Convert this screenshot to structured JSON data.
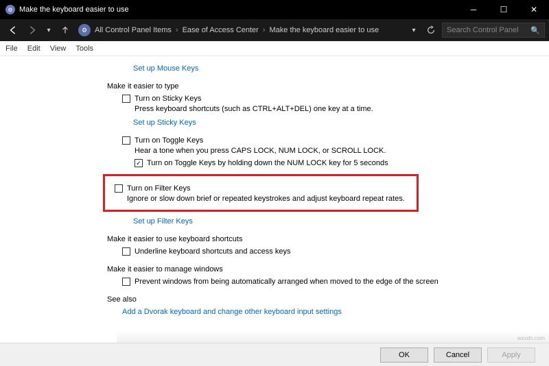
{
  "titlebar": {
    "title": "Make the keyboard easier to use"
  },
  "breadcrumb": {
    "items": [
      "All Control Panel Items",
      "Ease of Access Center",
      "Make the keyboard easier to use"
    ]
  },
  "search": {
    "placeholder": "Search Control Panel"
  },
  "menubar": {
    "file": "File",
    "edit": "Edit",
    "view": "View",
    "tools": "Tools"
  },
  "content": {
    "link_mouse_keys": "Set up Mouse Keys",
    "section_type": "Make it easier to type",
    "sticky_label": "Turn on Sticky Keys",
    "sticky_desc": "Press keyboard shortcuts (such as CTRL+ALT+DEL) one key at a time.",
    "link_sticky": "Set up Sticky Keys",
    "toggle_label": "Turn on Toggle Keys",
    "toggle_desc": "Hear a tone when you press CAPS LOCK, NUM LOCK, or SCROLL LOCK.",
    "toggle_hold_label": "Turn on Toggle Keys by holding down the NUM LOCK key for 5 seconds",
    "filter_label": "Turn on Filter Keys",
    "filter_desc": "Ignore or slow down brief or repeated keystrokes and adjust keyboard repeat rates.",
    "link_filter": "Set up Filter Keys",
    "section_shortcuts": "Make it easier to use keyboard shortcuts",
    "underline_label": "Underline keyboard shortcuts and access keys",
    "section_windows": "Make it easier to manage windows",
    "prevent_label": "Prevent windows from being automatically arranged when moved to the edge of the screen",
    "see_also": "See also",
    "dvorak_link": "Add a Dvorak keyboard and change other keyboard input settings"
  },
  "footer": {
    "ok": "OK",
    "cancel": "Cancel",
    "apply": "Apply"
  },
  "watermark": "wsxdn.com"
}
